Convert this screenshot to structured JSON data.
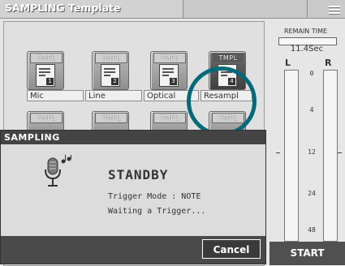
{
  "title": "SAMPLING Template",
  "tiles": [
    {
      "label": "TMPL",
      "num": "1",
      "caption": "Mic"
    },
    {
      "label": "TMPL",
      "num": "2",
      "caption": "Line"
    },
    {
      "label": "TMPL",
      "num": "3",
      "caption": "Optical"
    },
    {
      "label": "TMPL",
      "num": "4",
      "caption": "Resampl"
    }
  ],
  "tiles_row2": [
    "TMPL",
    "TMPL",
    "TMPL",
    "TMPL"
  ],
  "dialog": {
    "title": "SAMPLING",
    "status": "STANDBY",
    "trigger_mode": "Trigger Mode : NOTE",
    "waiting": "Waiting a Trigger...",
    "cancel": "Cancel"
  },
  "side": {
    "remain_label": "REMAIN TIME",
    "remain_value": "11.4Sec",
    "left": "L",
    "right": "R",
    "ticks": [
      "0",
      "4",
      "12",
      "24",
      "48"
    ],
    "start": "START"
  },
  "colors": {
    "highlight_ring": "#006a78"
  }
}
